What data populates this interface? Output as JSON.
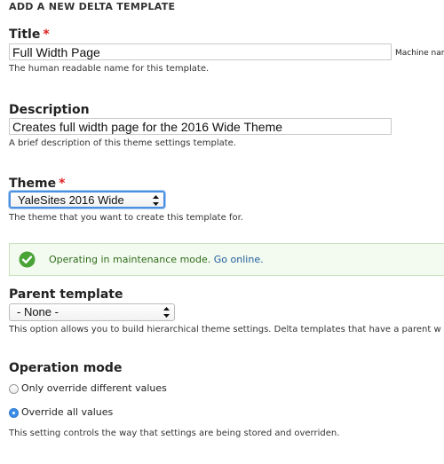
{
  "form": {
    "heading": "ADD A NEW DELTA TEMPLATE",
    "required_marker": "*",
    "title": {
      "label": "Title",
      "value": "Full Width Page",
      "description": "The human readable name for this template.",
      "machine_name_label": "Machine name"
    },
    "description": {
      "label": "Description",
      "value": "Creates full width page for the 2016 Wide Theme",
      "description": "A brief description of this theme settings template."
    },
    "theme": {
      "label": "Theme",
      "selected": "YaleSites 2016 Wide",
      "description": "The theme that you want to create this template for."
    },
    "message": {
      "text": "Operating in maintenance mode.",
      "link_label": "Go online."
    },
    "parent_template": {
      "label": "Parent template",
      "selected": "- None -",
      "description": "This option allows you to build hierarchical theme settings. Delta templates that have a parent w"
    },
    "operation_mode": {
      "label": "Operation mode",
      "options": [
        {
          "label": "Only override different values",
          "checked": false
        },
        {
          "label": "Override all values",
          "checked": true
        }
      ],
      "description": "This setting controls the way that settings are being stored and overriden."
    }
  },
  "icons": {
    "message_icon": "check-circle-icon",
    "select_icon": "select-arrows-icon"
  },
  "colors": {
    "required": "#e02020",
    "focus_border": "#4a90e2",
    "status_bg": "#f3faef",
    "status_text": "#2f6d1c",
    "link": "#1d5e9c",
    "check_icon": "#4aa337",
    "radio_selected": "#3b8eea"
  }
}
